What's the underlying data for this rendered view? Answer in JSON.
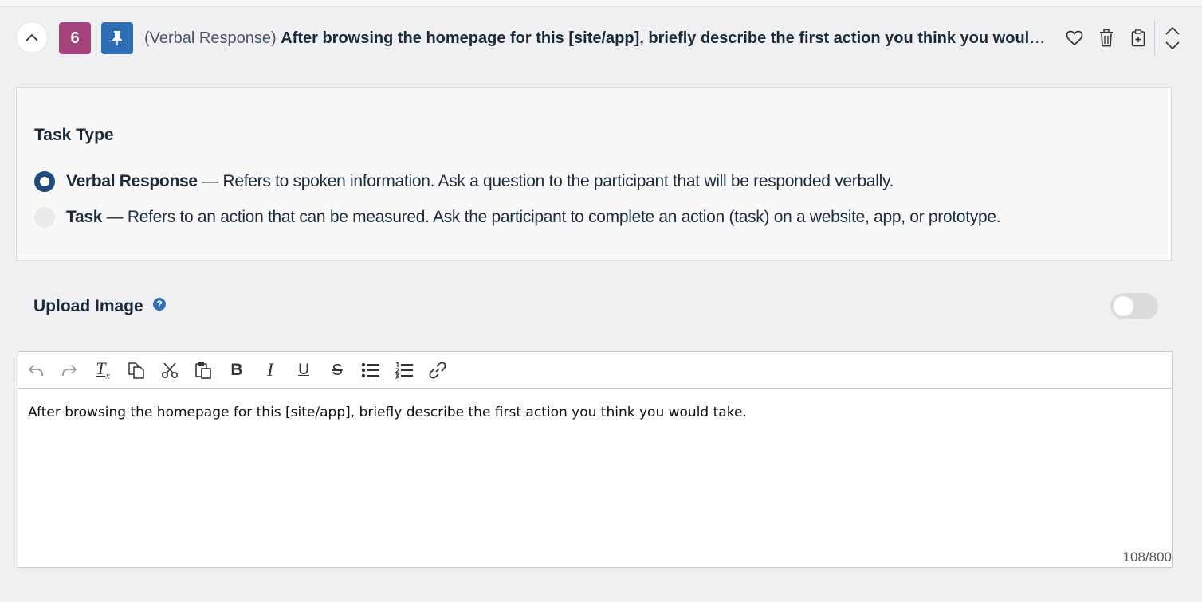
{
  "question": {
    "number": "6",
    "type_label": "(Verbal Response)",
    "title_text": "After browsing the homepage for this [site/app], briefly describe the first action you think you would take."
  },
  "task_type": {
    "heading": "Task Type",
    "options": [
      {
        "name": "Verbal Response",
        "description": " — Refers to spoken information. Ask a question to the participant that will be responded verbally.",
        "selected": true
      },
      {
        "name": "Task",
        "description": " — Refers to an action that can be measured. Ask the participant to complete an action (task) on a website, app, or prototype.",
        "selected": false
      }
    ]
  },
  "upload_image": {
    "label": "Upload Image",
    "help_glyph": "?",
    "enabled": false
  },
  "editor": {
    "toolbar": {
      "bold": "B",
      "italic": "I",
      "underline": "U",
      "strikethrough": "S",
      "clear_format": "T",
      "clear_format_sub": "x"
    },
    "content": "After browsing the homepage for this [site/app], briefly describe the first action you think you would take.",
    "counter": "108/800"
  },
  "colors": {
    "number_badge": "#a3427c",
    "pin_badge": "#2f6db5",
    "radio_selected": "#1f4a7a",
    "text": "#1d2a3a"
  },
  "icons": {
    "header": [
      "chevron-up-icon",
      "pin-icon",
      "heart-icon",
      "trash-icon",
      "clipboard-add-icon",
      "reorder-icon"
    ],
    "toolbar": [
      "undo-icon",
      "redo-icon",
      "clear-format-icon",
      "copy-icon",
      "cut-icon",
      "paste-icon",
      "bold-icon",
      "italic-icon",
      "underline-icon",
      "strikethrough-icon",
      "bulleted-list-icon",
      "numbered-list-icon",
      "link-icon"
    ]
  }
}
